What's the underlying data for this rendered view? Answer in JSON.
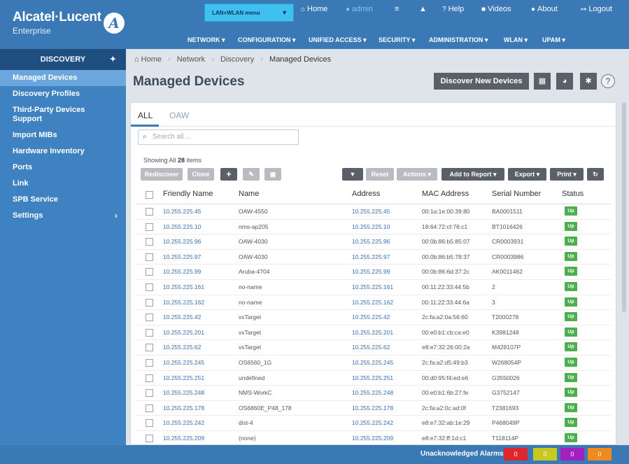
{
  "header": {
    "brand": "Alcatel·Lucent",
    "brand_sub": "Enterprise",
    "brand_mark": "A",
    "menu_select": "LAN+WLAN menu",
    "top_links": {
      "home": "Home",
      "admin": "admin",
      "help": "Help",
      "videos": "Videos",
      "about": "About",
      "logout": "Logout"
    },
    "main_nav": [
      "NETWORK ▾",
      "CONFIGURATION ▾",
      "UNIFIED ACCESS ▾",
      "SECURITY ▾",
      "ADMINISTRATION ▾",
      "WLAN ▾",
      "UPAM ▾"
    ]
  },
  "sidebar": {
    "title": "DISCOVERY",
    "items": [
      {
        "label": "Managed Devices"
      },
      {
        "label": "Discovery Profiles"
      },
      {
        "label": "Third-Party Devices\nSupport"
      },
      {
        "label": "Import MIBs"
      },
      {
        "label": "Hardware Inventory"
      },
      {
        "label": "Ports"
      },
      {
        "label": "Link"
      },
      {
        "label": "SPB Service"
      },
      {
        "label": "Settings"
      }
    ]
  },
  "breadcrumb": {
    "home": "Home",
    "network": "Network",
    "discovery": "Discovery",
    "current": "Managed Devices"
  },
  "page": {
    "title": "Managed Devices",
    "discover_button": "Discover New Devices"
  },
  "tabs": [
    "ALL",
    "OAW"
  ],
  "search": {
    "placeholder": "Search all ..."
  },
  "showing": {
    "prefix": "Showing All",
    "count": "28",
    "suffix": "items"
  },
  "toolbar": {
    "rediscover": "Rediscover",
    "clone": "Clone",
    "reset": "Reset",
    "actions": "Actions ▾",
    "add_to_report": "Add to Report ▾",
    "export": "Export ▾",
    "print": "Print ▾"
  },
  "table": {
    "headers": [
      "Friendly Name",
      "Name",
      "Address",
      "MAC Address",
      "Serial Number",
      "Status"
    ],
    "rows": [
      {
        "friendly": "10.255.225.45",
        "name": "OAW-4550",
        "address": "10.255.225.45",
        "mac": "00:1a:1e:00:39:80",
        "serial": "BA0001511",
        "status": "Up"
      },
      {
        "friendly": "10.255.225.10",
        "name": "nms-ap205",
        "address": "10.255.225.10",
        "mac": "18:64:72:cf:76:c1",
        "serial": "BT1016426",
        "status": "Up"
      },
      {
        "friendly": "10.255.225.96",
        "name": "OAW-4030",
        "address": "10.255.225.96",
        "mac": "00:0b:86:b5:85:07",
        "serial": "CR0003931",
        "status": "Up"
      },
      {
        "friendly": "10.255.225.97",
        "name": "OAW-4030",
        "address": "10.255.225.97",
        "mac": "00:0b:86:b5:78:37",
        "serial": "CR0003986",
        "status": "Up"
      },
      {
        "friendly": "10.255.225.99",
        "name": "Aruba-4704",
        "address": "10.255.225.99",
        "mac": "00:0b:86:6d:37:2c",
        "serial": "AK0011462",
        "status": "Up"
      },
      {
        "friendly": "10.255.225.161",
        "name": "no-name",
        "address": "10.255.225.161",
        "mac": "00:11:22:33:44:5b",
        "serial": "2",
        "status": "Up"
      },
      {
        "friendly": "10.255.225.162",
        "name": "no-name",
        "address": "10.255.225.162",
        "mac": "00:11:22:33:44:6a",
        "serial": "3",
        "status": "Up"
      },
      {
        "friendly": "10.255.225.42",
        "name": "vxTarget",
        "address": "10.255.225.42",
        "mac": "2c:fa:a2:0a:56:60",
        "serial": "T2000278",
        "status": "Up"
      },
      {
        "friendly": "10.255.225.201",
        "name": "vxTarget",
        "address": "10.255.225.201",
        "mac": "00:e0:b1:cb:ca:e0",
        "serial": "K3981248",
        "status": "Up"
      },
      {
        "friendly": "10.255.225.62",
        "name": "vxTarget",
        "address": "10.255.225.62",
        "mac": "e8:e7:32:26:00:2a",
        "serial": "M428107P",
        "status": "Up"
      },
      {
        "friendly": "10.255.225.245",
        "name": "OS6560_1G",
        "address": "10.255.225.245",
        "mac": "2c:fa:a2:d5:49:b3",
        "serial": "W268054P",
        "status": "Up"
      },
      {
        "friendly": "10.255.225.251",
        "name": "undefined",
        "address": "10.255.225.251",
        "mac": "00:d0:95:f4:ed:e6",
        "serial": "G3550026",
        "status": "Up"
      },
      {
        "friendly": "10.255.225.248",
        "name": "NMS-WorkC",
        "address": "10.255.225.248",
        "mac": "00:e0:b1:6b:27:fe",
        "serial": "G3752147",
        "status": "Up"
      },
      {
        "friendly": "10.255.225.178",
        "name": "OS6860E_P48_178",
        "address": "10.255.225.178",
        "mac": "2c:fa:a2:0c:ad:0f",
        "serial": "T2381693",
        "status": "Up"
      },
      {
        "friendly": "10.255.225.242",
        "name": "dist-4",
        "address": "10.255.225.242",
        "mac": "e8:e7:32:ab:1e:29",
        "serial": "P468049P",
        "status": "Up"
      },
      {
        "friendly": "10.255.225.209",
        "name": "(none)",
        "address": "10.255.225.209",
        "mac": "e8:e7:32:ff:1d:c1",
        "serial": "T118114P",
        "status": "Up"
      }
    ]
  },
  "footer": {
    "label": "Unacknowledged Alarms:",
    "alarms": [
      {
        "count": "0",
        "color": "#e0262d"
      },
      {
        "count": "0",
        "color": "#c8c81e"
      },
      {
        "count": "0",
        "color": "#a020c0"
      },
      {
        "count": "0",
        "color": "#f08a1e"
      }
    ]
  },
  "colors": {
    "header_blue": "#3b79b6",
    "sidebar_blue": "#3f82c2",
    "sidebar_head": "#1e4f80",
    "status_up": "#4cae4c",
    "menu_select": "#3ec0f0"
  }
}
